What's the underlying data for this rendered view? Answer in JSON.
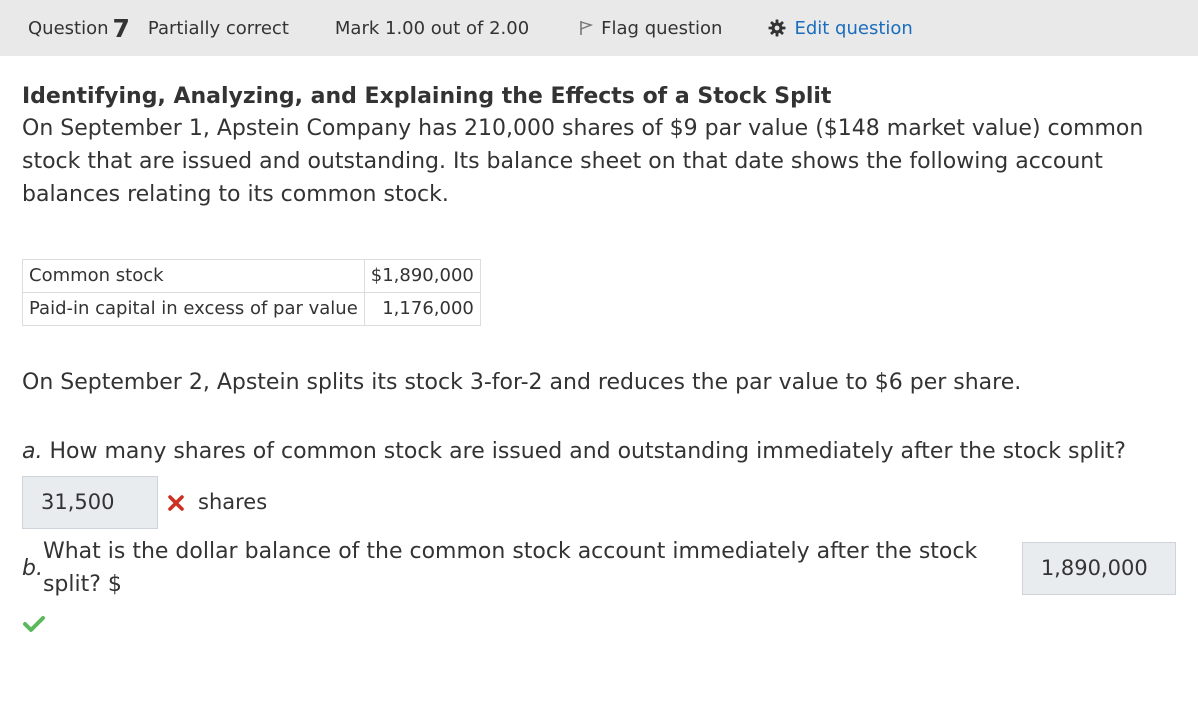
{
  "header": {
    "question_label": "Question",
    "question_number": "7",
    "state": "Partially correct",
    "mark": "Mark 1.00 out of 2.00",
    "flag_label": "Flag question",
    "edit_label": "Edit question"
  },
  "question": {
    "title": "Identifying, Analyzing, and Explaining the Effects of a Stock Split",
    "intro": "On September 1, Apstein Company has 210,000 shares of $9 par value ($148 market value) common stock that are issued and outstanding. Its balance sheet on that date shows the following account balances relating to its common stock.",
    "table": [
      {
        "account": "Common stock",
        "amount": "$1,890,000"
      },
      {
        "account": "Paid-in capital in excess of par value",
        "amount": "1,176,000"
      }
    ],
    "split_text": "On September 2, Apstein splits its stock 3-for-2 and reduces the par value to $6 per share.",
    "part_a": {
      "letter": "a.",
      "text": " How many shares of common stock are issued and outstanding immediately after the stock split?",
      "answer": "31,500",
      "unit": "shares",
      "status": "incorrect"
    },
    "part_b": {
      "letter": "b.",
      "text": " What is the dollar balance of the common stock account immediately after the stock split? $",
      "answer": "1,890,000",
      "status": "correct"
    }
  },
  "colors": {
    "header_bg": "#e9e9e9",
    "link": "#1a6dbd",
    "incorrect": "#ca3120",
    "correct": "#5cb85c",
    "answer_bg": "#e9ecef"
  }
}
